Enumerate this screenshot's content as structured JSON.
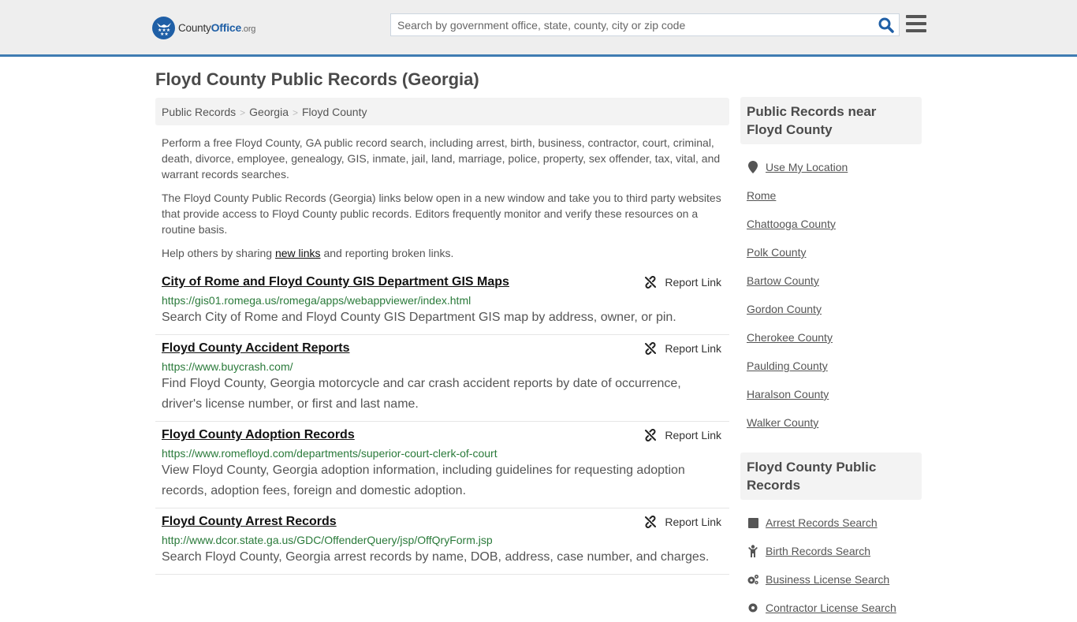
{
  "header": {
    "logo": {
      "brand_main": "County",
      "brand_accent": "Office",
      "brand_suffix": ".org"
    },
    "search": {
      "placeholder": "Search by government office, state, county, city or zip code",
      "value": ""
    },
    "icons": {
      "search": "search-icon",
      "menu": "hamburger-menu-icon"
    }
  },
  "page": {
    "title": "Floyd County Public Records (Georgia)",
    "breadcrumb": [
      {
        "label": "Public Records"
      },
      {
        "label": "Georgia"
      },
      {
        "label": "Floyd County"
      }
    ],
    "breadcrumb_separator": ">",
    "intro": {
      "p1": "Perform a free Floyd County, GA public record search, including arrest, birth, business, contractor, court, criminal, death, divorce, employee, genealogy, GIS, inmate, jail, land, marriage, police, property, sex offender, tax, vital, and warrant records searches.",
      "p2": "The Floyd County Public Records (Georgia) links below open in a new window and take you to third party websites that provide access to Floyd County public records. Editors frequently monitor and verify these resources on a routine basis.",
      "p3_before": "Help others by sharing ",
      "p3_link": "new links",
      "p3_after": " and reporting broken links."
    },
    "report_link_label": "Report Link",
    "records": [
      {
        "title": "City of Rome and Floyd County GIS Department GIS Maps",
        "url": "https://gis01.romega.us/romega/apps/webappviewer/index.html",
        "description": "Search City of Rome and Floyd County GIS Department GIS map by address, owner, or pin."
      },
      {
        "title": "Floyd County Accident Reports",
        "url": "https://www.buycrash.com/",
        "description": "Find Floyd County, Georgia motorcycle and car crash accident reports by date of occurrence, driver's license number, or first and last name."
      },
      {
        "title": "Floyd County Adoption Records",
        "url": "https://www.romefloyd.com/departments/superior-court-clerk-of-court",
        "description": "View Floyd County, Georgia adoption information, including guidelines for requesting adoption records, adoption fees, foreign and domestic adoption."
      },
      {
        "title": "Floyd County Arrest Records",
        "url": "http://www.dcor.state.ga.us/GDC/OffenderQuery/jsp/OffQryForm.jsp",
        "description": "Search Floyd County, Georgia arrest records by name, DOB, address, case number, and charges."
      }
    ]
  },
  "sidebar": {
    "nearby": {
      "heading": "Public Records near Floyd County",
      "use_location": "Use My Location",
      "items": [
        "Rome",
        "Chattooga County",
        "Polk County",
        "Bartow County",
        "Gordon County",
        "Cherokee County",
        "Paulding County",
        "Haralson County",
        "Walker County"
      ]
    },
    "county_records": {
      "heading": "Floyd County Public Records",
      "items": [
        {
          "label": "Arrest Records Search",
          "icon": "square-icon"
        },
        {
          "label": "Birth Records Search",
          "icon": "child-icon"
        },
        {
          "label": "Business License Search",
          "icon": "cogs-icon"
        },
        {
          "label": "Contractor License Search",
          "icon": "gear-icon"
        }
      ]
    }
  },
  "colors": {
    "header_bg": "#eeeeee",
    "header_border": "#3f7cb2",
    "brand_blue": "#1f5fa6",
    "url_green": "#2a7a3a",
    "panel_bg": "#f3f3f3"
  }
}
